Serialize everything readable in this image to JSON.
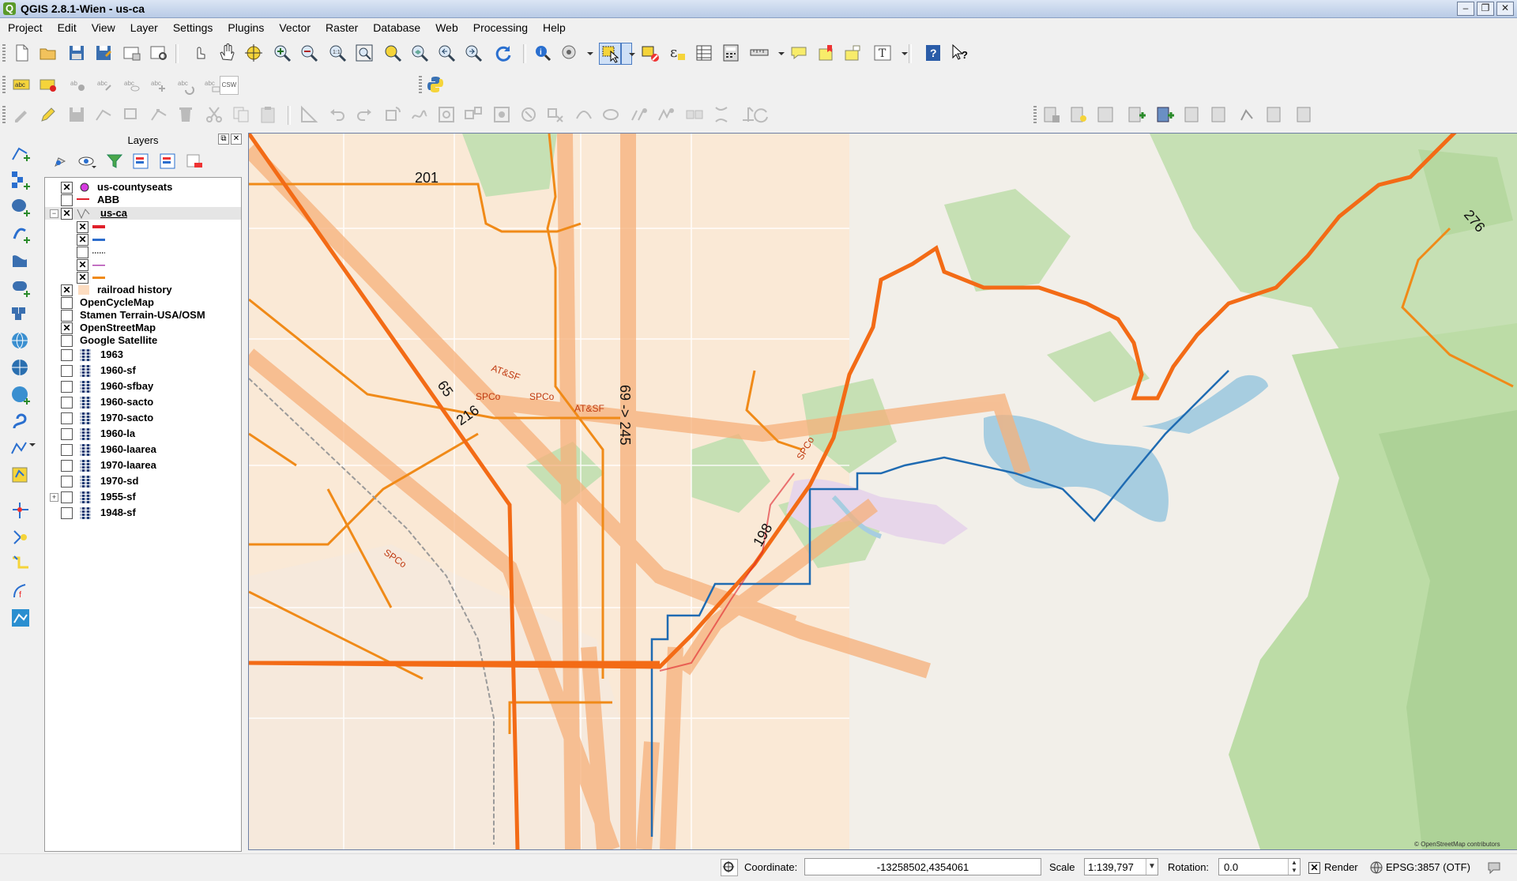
{
  "window": {
    "title": "QGIS 2.8.1-Wien - us-ca",
    "min": "–",
    "max": "❐",
    "close": "✕"
  },
  "menu": [
    "Project",
    "Edit",
    "View",
    "Layer",
    "Settings",
    "Plugins",
    "Vector",
    "Raster",
    "Database",
    "Web",
    "Processing",
    "Help"
  ],
  "toolbar_text": {
    "csw": "CSW"
  },
  "layers_panel": {
    "title": "Layers",
    "items": [
      {
        "label": "us-countyseats",
        "checked": true
      },
      {
        "label": "ABB",
        "checked": false
      },
      {
        "label": "us-ca",
        "checked": true
      },
      {
        "label": "railroad history",
        "checked": true
      },
      {
        "label": "OpenCycleMap",
        "checked": false
      },
      {
        "label": "Stamen Terrain-USA/OSM",
        "checked": false
      },
      {
        "label": "OpenStreetMap",
        "checked": true
      },
      {
        "label": "Google Satellite",
        "checked": false
      },
      {
        "label": "1963",
        "checked": false
      },
      {
        "label": "1960-sf",
        "checked": false
      },
      {
        "label": "1960-sfbay",
        "checked": false
      },
      {
        "label": "1960-sacto",
        "checked": false
      },
      {
        "label": "1970-sacto",
        "checked": false
      },
      {
        "label": "1960-la",
        "checked": false
      },
      {
        "label": "1960-laarea",
        "checked": false
      },
      {
        "label": "1970-laarea",
        "checked": false
      },
      {
        "label": "1970-sd",
        "checked": false
      },
      {
        "label": "1955-sf",
        "checked": false
      },
      {
        "label": "1948-sf",
        "checked": false
      }
    ],
    "symbols": [
      {
        "color": "#e0202a",
        "checked": true,
        "style": "solid"
      },
      {
        "color": "#2c6ccc",
        "checked": true,
        "style": "solid"
      },
      {
        "color": "#333333",
        "checked": false,
        "style": "dotted"
      },
      {
        "color": "#b044b0",
        "checked": true,
        "style": "solid"
      },
      {
        "color": "#f08a18",
        "checked": true,
        "style": "solid"
      }
    ]
  },
  "map_labels": {
    "r201": "201",
    "r65": "65",
    "r216": "216",
    "r69": "69 -> 245",
    "r198": "198",
    "r276": "276",
    "spco1": "SPCo",
    "spco2": "SPCo",
    "spco3": "SPCo",
    "spco4": "SPCo",
    "atsf1": "AT&SF",
    "atsf2": "AT&SF",
    "attribution": "© OpenStreetMap contributors"
  },
  "status": {
    "coordinate_label": "Coordinate:",
    "coordinate_value": "-13258502,4354061",
    "scale_label": "Scale",
    "scale_value": "1:139,797",
    "rotation_label": "Rotation:",
    "rotation_value": "0.0",
    "render_label": "Render",
    "crs": "EPSG:3857 (OTF)"
  },
  "colors": {
    "route": "#f36b16",
    "rail": "#f6b07a",
    "county": "#1f6bb2",
    "forest": "#aed49a",
    "water": "#a7cde0",
    "urban": "#fcdcc0"
  }
}
